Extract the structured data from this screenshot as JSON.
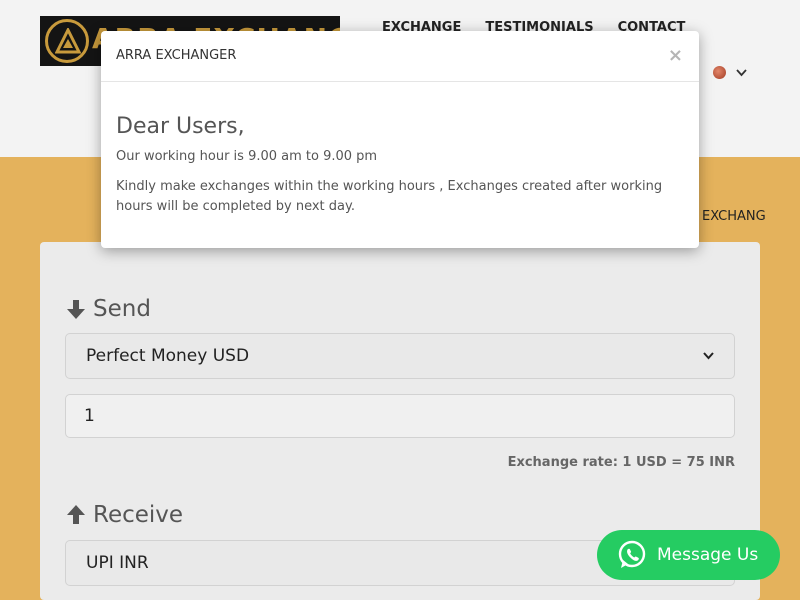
{
  "header": {
    "logo_text": "ARRA EXCHANGER",
    "nav": [
      "EXCHANGE",
      "TESTIMONIALS",
      "CONTACT"
    ]
  },
  "band": {
    "partial_text": "EXCHANG"
  },
  "exchange": {
    "send_label": "Send",
    "send_currency": "Perfect Money USD",
    "send_amount": "1",
    "rate_text": "Exchange rate: 1 USD = 75 INR",
    "receive_label": "Receive",
    "receive_currency": "UPI INR"
  },
  "whatsapp": {
    "label": "Message Us"
  },
  "modal": {
    "title": "ARRA EXCHANGER",
    "close": "×",
    "greeting": "Dear Users,",
    "line1": "Our working hour is 9.00 am to 9.00 pm",
    "line2": "Kindly make exchanges within the working hours , Exchanges created after working hours will be completed by next day."
  },
  "colors": {
    "accent_gold": "#e4b25c",
    "whatsapp_green": "#25cc62",
    "logo_gold": "#c89a3c"
  }
}
